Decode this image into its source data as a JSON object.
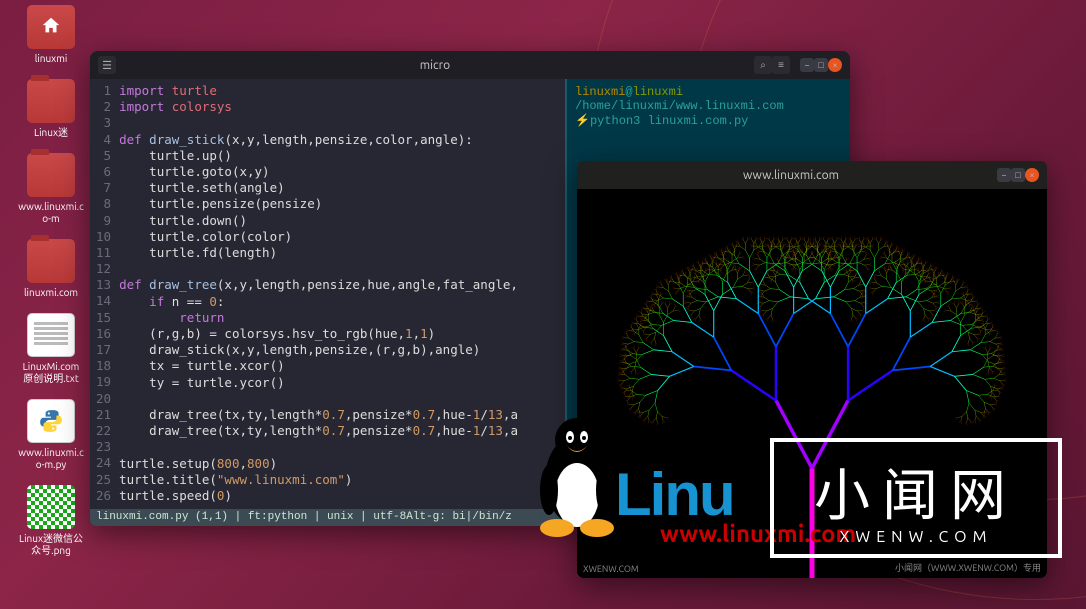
{
  "desktop": {
    "icons": [
      {
        "label": "linuxmi",
        "type": "home"
      },
      {
        "label": "Linux迷",
        "type": "folder"
      },
      {
        "label": "www.linuxmi.co-m",
        "type": "folder"
      },
      {
        "label": "linuxmi.com",
        "type": "folder"
      },
      {
        "label": "LinuxMi.com原创说明.txt",
        "type": "text"
      },
      {
        "label": "www.linuxmi.co-m.py",
        "type": "py"
      },
      {
        "label": "Linux迷微信公众号.png",
        "type": "qr"
      }
    ]
  },
  "micro": {
    "title": "micro",
    "code_lines": [
      {
        "n": 1,
        "html": "<span class='kw'>import</span> <span class='id'>turtle</span>"
      },
      {
        "n": 2,
        "html": "<span class='kw'>import</span> <span class='id'>colorsys</span>"
      },
      {
        "n": 3,
        "html": ""
      },
      {
        "n": 4,
        "html": "<span class='kw'>def</span> <span class='fn'>draw_stick</span>(x,y,length,pensize,color,angle):"
      },
      {
        "n": 5,
        "html": "    turtle.up()"
      },
      {
        "n": 6,
        "html": "    turtle.goto(x,y)"
      },
      {
        "n": 7,
        "html": "    turtle.seth(angle)"
      },
      {
        "n": 8,
        "html": "    turtle.pensize(pensize)"
      },
      {
        "n": 9,
        "html": "    turtle.down()"
      },
      {
        "n": 10,
        "html": "    turtle.color(color)"
      },
      {
        "n": 11,
        "html": "    turtle.fd(length)"
      },
      {
        "n": 12,
        "html": ""
      },
      {
        "n": 13,
        "html": "<span class='kw'>def</span> <span class='fn'>draw_tree</span>(x,y,length,pensize,hue,angle,fat_angle,"
      },
      {
        "n": 14,
        "html": "    <span class='kw'>if</span> n == <span class='num'>0</span>:"
      },
      {
        "n": 15,
        "html": "        <span class='kw'>return</span>"
      },
      {
        "n": 16,
        "html": "    (r,g,b) = colorsys.hsv_to_rgb(hue,<span class='num'>1</span>,<span class='num'>1</span>)"
      },
      {
        "n": 17,
        "html": "    draw_stick(x,y,length,pensize,(r,g,b),angle)"
      },
      {
        "n": 18,
        "html": "    tx = turtle.xcor()"
      },
      {
        "n": 19,
        "html": "    ty = turtle.ycor()"
      },
      {
        "n": 20,
        "html": ""
      },
      {
        "n": 21,
        "html": "    draw_tree(tx,ty,length*<span class='num'>0.7</span>,pensize*<span class='num'>0.7</span>,hue-<span class='num'>1</span>/<span class='num'>13</span>,a"
      },
      {
        "n": 22,
        "html": "    draw_tree(tx,ty,length*<span class='num'>0.7</span>,pensize*<span class='num'>0.7</span>,hue-<span class='num'>1</span>/<span class='num'>13</span>,a"
      },
      {
        "n": 23,
        "html": ""
      },
      {
        "n": 24,
        "html": "turtle.setup(<span class='num'>800</span>,<span class='num'>800</span>)"
      },
      {
        "n": 25,
        "html": "turtle.title(<span class='str'>\"www.linuxmi.com\"</span>)"
      },
      {
        "n": 26,
        "html": "turtle.speed(<span class='num'>0</span>)"
      }
    ],
    "statusbar": "linuxmi.com.py (1,1) | ft:python | unix | utf-8Alt-g: bi|/bin/z",
    "terminal": {
      "user": "linuxmi",
      "host": "linuxmi",
      "path": "/home/linuxmi/www.linuxmi.com",
      "cmd": "python3 linuxmi.com.py"
    }
  },
  "turtle_window": {
    "title": "www.linuxmi.com"
  },
  "watermark": {
    "linux_logo": "Linu",
    "linux_url": "www.linuxmi.com",
    "cn": "小闻网",
    "en": "XWENW.COM",
    "footer_left": "XWENW.COM",
    "footer_right": "小闻网（WWW.XWENW.COM）专用"
  }
}
